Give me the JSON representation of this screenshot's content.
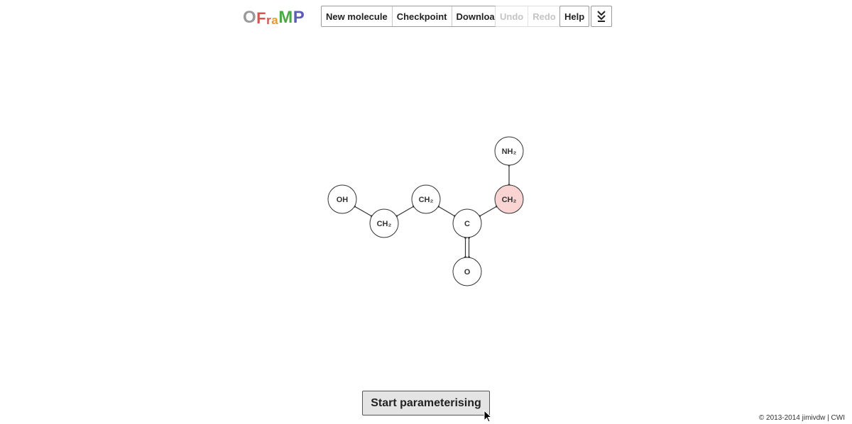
{
  "logo": {
    "letters": [
      "O",
      "F",
      "r",
      "a",
      "M",
      "P"
    ],
    "colors": [
      "#9a9a9a",
      "#d9534f",
      "#d9534f",
      "#e89a2c",
      "#4aa84a",
      "#5c5cb8"
    ]
  },
  "toolbar": {
    "new_molecule": "New molecule",
    "checkpoint": "Checkpoint",
    "download": "Download",
    "undo": "Undo",
    "redo": "Redo",
    "help": "Help",
    "menu_icon": "double-chevron-down-icon"
  },
  "molecule": {
    "atoms": [
      {
        "id": "oh",
        "label": "OH",
        "selected": false
      },
      {
        "id": "ch2a",
        "label": "CH₂",
        "selected": false
      },
      {
        "id": "ch2b",
        "label": "CH₂",
        "selected": false
      },
      {
        "id": "c",
        "label": "C",
        "selected": false
      },
      {
        "id": "ch2c",
        "label": "CH₂",
        "selected": true
      },
      {
        "id": "nh2",
        "label": "NH₂",
        "selected": false
      },
      {
        "id": "o",
        "label": "O",
        "selected": false
      }
    ],
    "bonds": [
      {
        "from": "oh",
        "to": "ch2a",
        "order": 1
      },
      {
        "from": "ch2a",
        "to": "ch2b",
        "order": 1
      },
      {
        "from": "ch2b",
        "to": "c",
        "order": 1
      },
      {
        "from": "c",
        "to": "ch2c",
        "order": 1
      },
      {
        "from": "ch2c",
        "to": "nh2",
        "order": 1
      },
      {
        "from": "c",
        "to": "o",
        "order": 2
      }
    ],
    "selected_fill": "#f9d4d2"
  },
  "start_button": "Start parameterising",
  "copyright": "© 2013-2014 jimivdw | CWI"
}
